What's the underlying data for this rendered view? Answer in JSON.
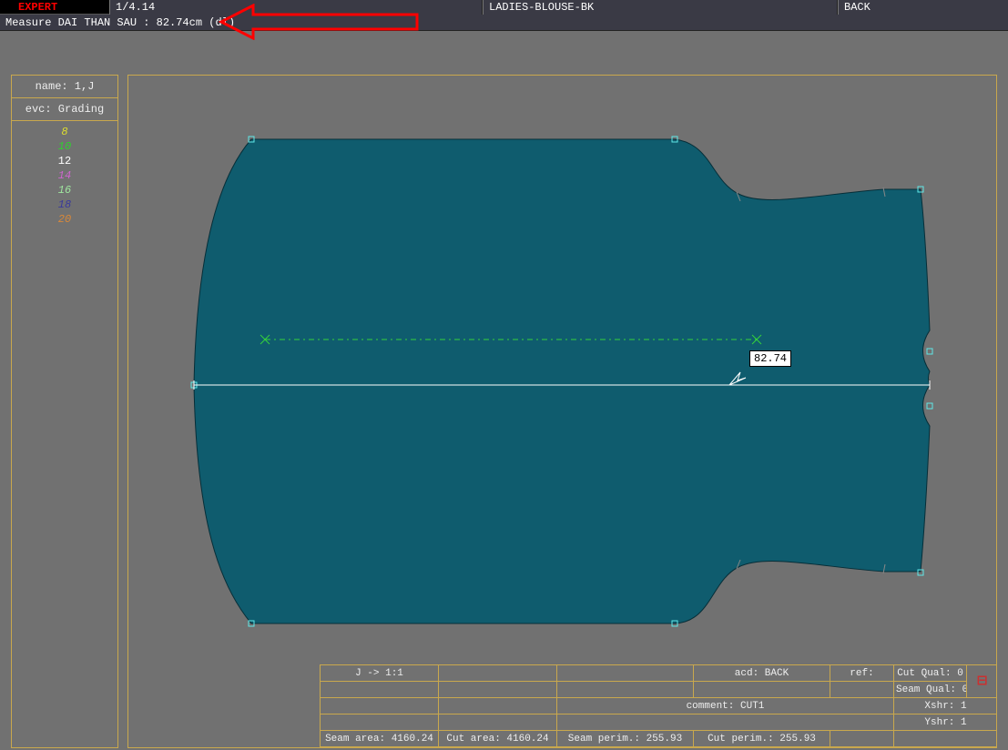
{
  "titlebar": {
    "expert": "EXPERT",
    "scale": "1/4.14",
    "model": "LADIES-BLOUSE-BK",
    "part": "BACK"
  },
  "measurebar": "Measure DAI THAN SAU : 82.74cm (dl)",
  "sidebar": {
    "name_label": "name: 1,J",
    "evc_label": "evc: Grading",
    "sizes": [
      "8",
      "10",
      "12",
      "14",
      "16",
      "18",
      "20"
    ]
  },
  "canvas": {
    "measurement_value": "82.74"
  },
  "info": {
    "piece_ratio": "J -> 1:1",
    "acd": "acd: BACK",
    "ref": "ref:",
    "cut_qual": "Cut Qual: 0",
    "seam_qual": "Seam Qual: 0",
    "comment": "comment: CUT1",
    "xshr": "Xshr: 1",
    "yshr": "Yshr: 1",
    "seam_area": "Seam area: 4160.24",
    "cut_area": "Cut area: 4160.24",
    "seam_perim": "Seam perim.: 255.93",
    "cut_perim": "Cut perim.: 255.93"
  }
}
